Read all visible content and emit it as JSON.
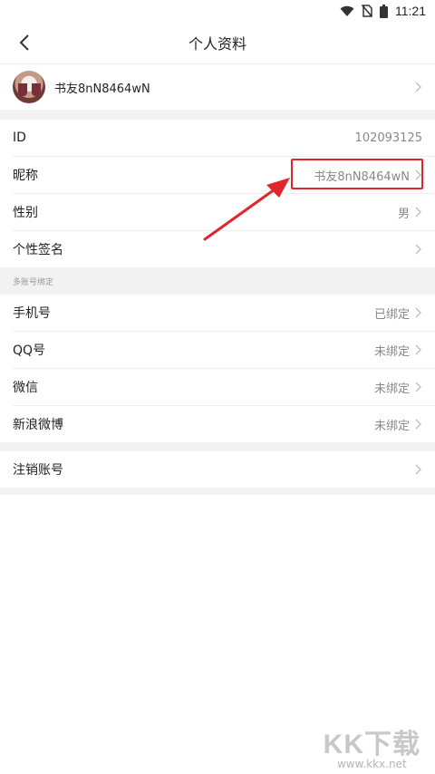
{
  "status_bar": {
    "time": "11:21",
    "icons": [
      "wifi-icon",
      "no-sim-icon",
      "battery-icon"
    ]
  },
  "header": {
    "back_icon": "back-arrow-icon",
    "title": "个人资料"
  },
  "profile": {
    "username": "书友8nN8464wN"
  },
  "info_rows": [
    {
      "label": "ID",
      "value": "102093125"
    },
    {
      "label": "昵称",
      "value": "书友8nN8464wN"
    },
    {
      "label": "性别",
      "value": "男"
    },
    {
      "label": "个性签名",
      "value": ""
    }
  ],
  "binding_section": {
    "title": "多账号绑定",
    "rows": [
      {
        "label": "手机号",
        "value": "已绑定"
      },
      {
        "label": "QQ号",
        "value": "未绑定"
      },
      {
        "label": "微信",
        "value": "未绑定"
      },
      {
        "label": "新浪微博",
        "value": "未绑定"
      }
    ]
  },
  "cancel_account": {
    "label": "注销账号"
  },
  "annotation": {
    "highlight_color": "#e0262b"
  },
  "watermark": {
    "logo_text": "KK下载",
    "url": "www.kkx.net"
  }
}
